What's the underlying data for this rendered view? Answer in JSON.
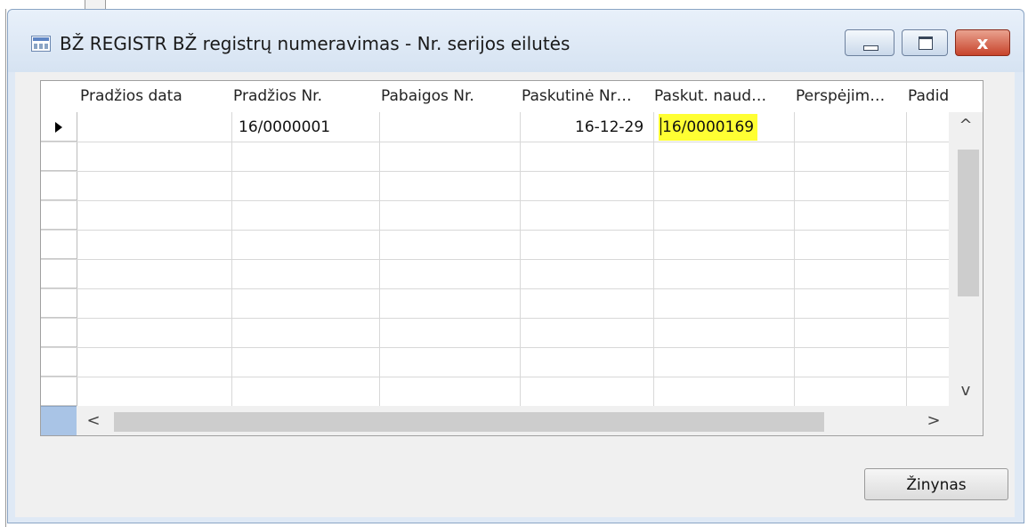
{
  "window": {
    "title": "BŽ REGISTR BŽ registrų numeravimas - Nr. serijos eilutės",
    "minimize_glyph": "",
    "maximize_glyph": "",
    "close_glyph": "x"
  },
  "table": {
    "columns": [
      "Pradžios data",
      "Pradžios Nr.",
      "Pabaigos Nr.",
      "Paskutinė Nr…",
      "Paskut. naud…",
      "Perspėjim…",
      "Padidint"
    ],
    "rows": [
      {
        "start_date": "",
        "start_no": "16/0000001",
        "end_no": "",
        "last_date": "16-12-29",
        "last_used_no": "16/0000169",
        "warning": "",
        "increment": ""
      }
    ]
  },
  "scroll": {
    "up_glyph": "^",
    "down_glyph": "v",
    "left_glyph": "<",
    "right_glyph": ">"
  },
  "buttons": {
    "help_label": "Žinynas"
  },
  "colors": {
    "highlight": "#ffff33",
    "selection_corner": "#a9c4e6",
    "close_button": "#c7432b"
  }
}
